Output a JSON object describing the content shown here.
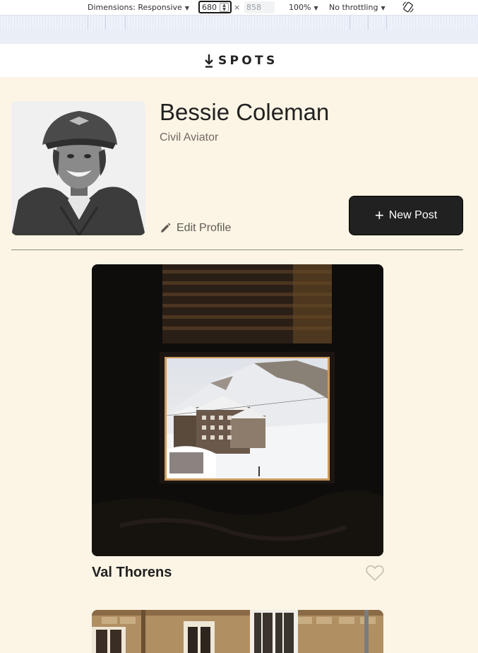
{
  "devtools": {
    "dimensions_label": "Dimensions: Responsive",
    "width_value": "680",
    "times_symbol": "×",
    "height_placeholder": "858",
    "zoom_label": "100%",
    "throttling_label": "No throttling"
  },
  "header": {
    "logo_text": "SPOTS"
  },
  "profile": {
    "name": "Bessie Coleman",
    "description": "Civil Aviator",
    "edit_label": "Edit Profile",
    "new_post_label": "New Post",
    "new_post_icon": "+"
  },
  "cards": [
    {
      "title": "Val Thorens",
      "liked": false
    },
    {
      "title": "",
      "liked": false
    }
  ],
  "colors": {
    "background": "#fcf5e5",
    "text_primary": "#212121",
    "text_secondary": "#6e6a63",
    "button_bg": "#212121"
  }
}
